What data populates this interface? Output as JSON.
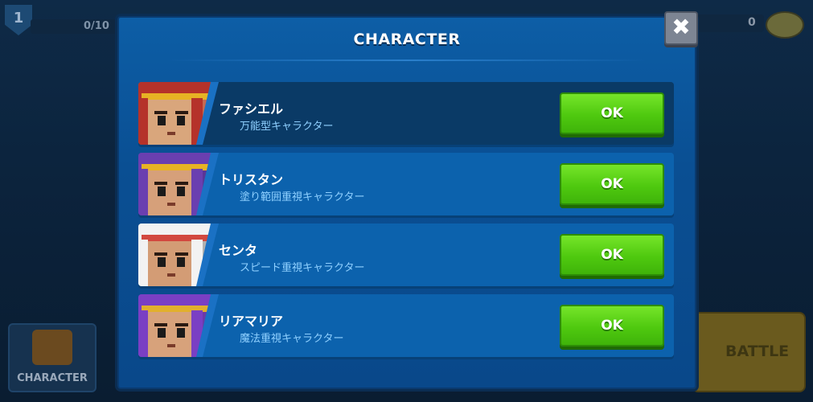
{
  "background": {
    "level": "1",
    "xp": "0/10",
    "coins": "0",
    "character_button": "CHARACTER",
    "battle_button": "BATTLE"
  },
  "modal": {
    "title": "CHARACTER",
    "close_label": "✖"
  },
  "characters": [
    {
      "name": "ファシエル",
      "description": "万能型キャラクター",
      "button": "OK",
      "selected": true,
      "colors": {
        "hair": "#b5322a",
        "band": "#e7b324",
        "skin": "#d9a67c",
        "bg": "#c46a52"
      }
    },
    {
      "name": "トリスタン",
      "description": "塗り範囲重視キャラクター",
      "button": "OK",
      "selected": false,
      "colors": {
        "hair": "#6a3fb0",
        "band": "#e7b324",
        "skin": "#d6a07a",
        "bg": "#5a3596"
      }
    },
    {
      "name": "センタ",
      "description": "スピード重視キャラクター",
      "button": "OK",
      "selected": false,
      "colors": {
        "hair": "#f2f2f2",
        "band": "#d2483f",
        "skin": "#d39c75",
        "bg": "#b0b0b0"
      }
    },
    {
      "name": "リアマリア",
      "description": "魔法重視キャラクター",
      "button": "OK",
      "selected": false,
      "colors": {
        "hair": "#7a3fc4",
        "band": "#e2b02c",
        "skin": "#d7a27b",
        "bg": "#6c3aa8"
      }
    }
  ]
}
